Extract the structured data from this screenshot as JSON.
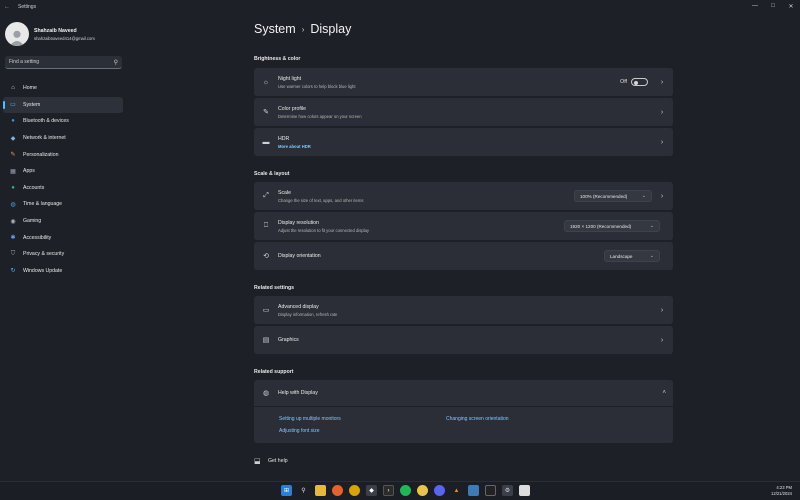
{
  "window": {
    "title": "Settings"
  },
  "profile": {
    "name": "Shahzaib Naveed",
    "email": "shahzaibnaveed414@gmail.com"
  },
  "search": {
    "placeholder": "Find a setting"
  },
  "nav": [
    {
      "label": "Home",
      "icon": "home-icon",
      "active": false
    },
    {
      "label": "System",
      "icon": "system-icon",
      "active": true
    },
    {
      "label": "Bluetooth & devices",
      "icon": "bluetooth-icon",
      "active": false
    },
    {
      "label": "Network & internet",
      "icon": "wifi-icon",
      "active": false
    },
    {
      "label": "Personalization",
      "icon": "brush-icon",
      "active": false
    },
    {
      "label": "Apps",
      "icon": "apps-icon",
      "active": false
    },
    {
      "label": "Accounts",
      "icon": "person-icon",
      "active": false
    },
    {
      "label": "Time & language",
      "icon": "globe-clock-icon",
      "active": false
    },
    {
      "label": "Gaming",
      "icon": "gamepad-icon",
      "active": false
    },
    {
      "label": "Accessibility",
      "icon": "accessibility-icon",
      "active": false
    },
    {
      "label": "Privacy & security",
      "icon": "shield-icon",
      "active": false
    },
    {
      "label": "Windows Update",
      "icon": "update-icon",
      "active": false
    }
  ],
  "breadcrumb": {
    "parent": "System",
    "current": "Display"
  },
  "sections": {
    "brightness": "Brightness & color",
    "scale_layout": "Scale & layout",
    "related_settings": "Related settings",
    "related_support": "Related support"
  },
  "night_light": {
    "title": "Night light",
    "subtitle": "Use warmer colors to help block blue light",
    "toggle_label": "Off",
    "on": false
  },
  "color_profile": {
    "title": "Color profile",
    "subtitle": "Determine how colors appear on your screen"
  },
  "hdr": {
    "title": "HDR",
    "subtitle": "More about HDR"
  },
  "scale": {
    "title": "Scale",
    "subtitle": "Change the size of text, apps, and other items",
    "value": "100% (Recommended)"
  },
  "resolution": {
    "title": "Display resolution",
    "subtitle": "Adjust the resolution to fit your connected display",
    "value": "1920 × 1200 (Recommended)"
  },
  "orientation": {
    "title": "Display orientation",
    "value": "Landscape"
  },
  "advanced": {
    "title": "Advanced display",
    "subtitle": "Display information, refresh rate"
  },
  "graphics": {
    "title": "Graphics"
  },
  "help": {
    "title": "Help with Display",
    "links": [
      "Setting up multiple monitors",
      "Changing screen orientation",
      "Adjusting font size"
    ]
  },
  "get_help": "Get help",
  "taskbar": {
    "icons": [
      "windows-start-icon",
      "search-icon",
      "file-explorer-icon",
      "firefox-icon",
      "chrome-icon",
      "app-icon",
      "terminal-icon",
      "spotify-icon",
      "chrome-canary-icon",
      "discord-icon",
      "vlc-icon",
      "photos-icon",
      "davinci-icon",
      "settings-icon",
      "app-icon-2"
    ],
    "time": "4:23 PM",
    "date": "12/21/2024"
  }
}
